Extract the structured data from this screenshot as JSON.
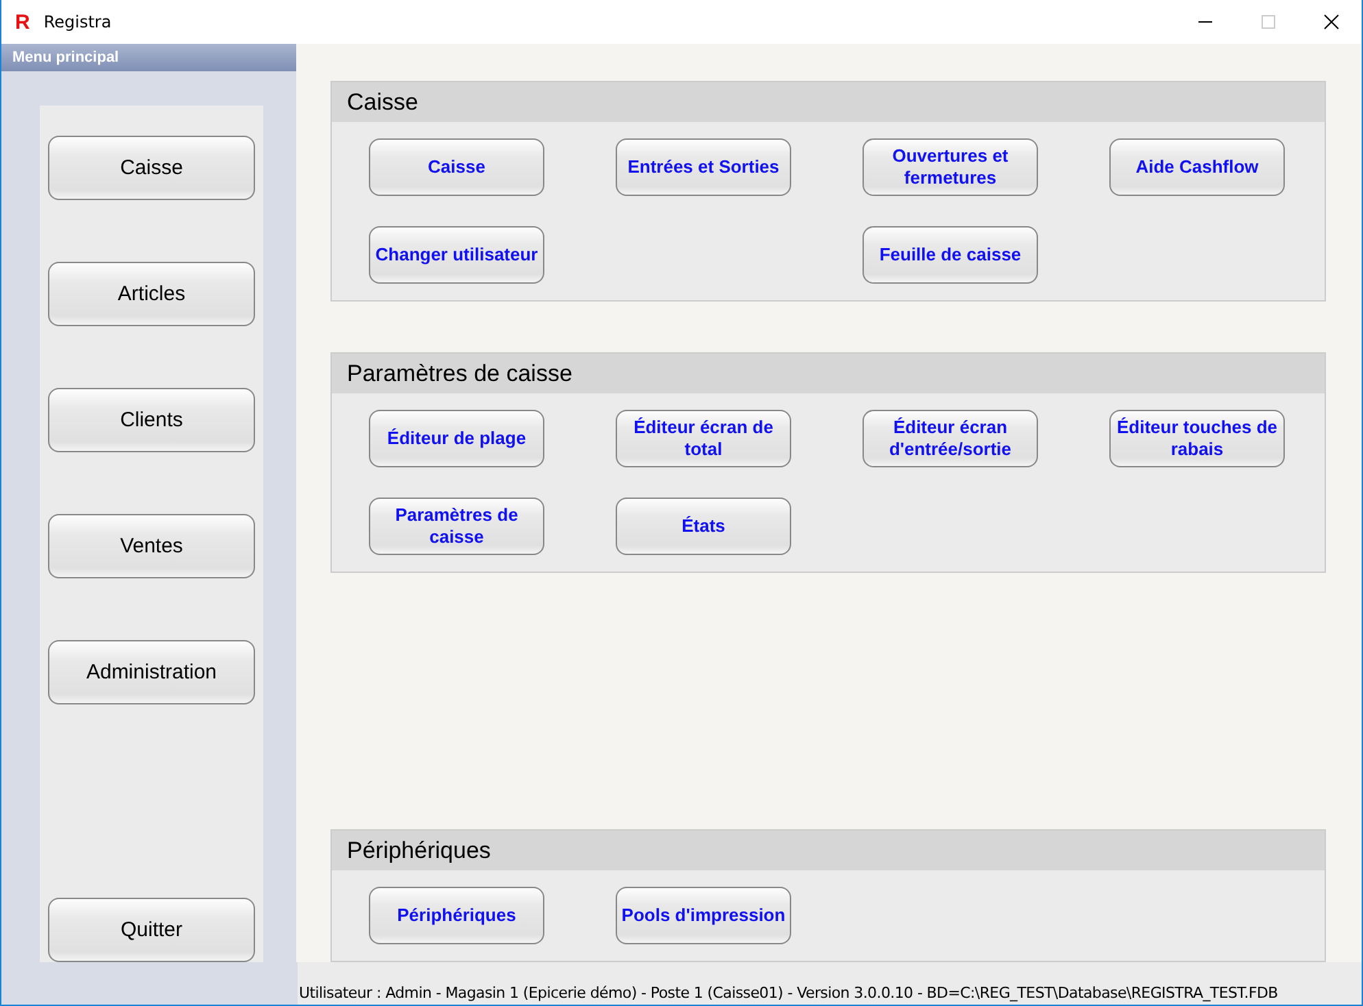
{
  "window": {
    "title": "Registra",
    "logo": "R"
  },
  "sidebar": {
    "title": "Menu principal",
    "items": [
      "Caisse",
      "Articles",
      "Clients",
      "Ventes",
      "Administration"
    ],
    "bottom_item": "Quitter"
  },
  "sections": [
    {
      "title": "Caisse",
      "rows": [
        [
          {
            "kind": "button",
            "label": "Caisse"
          },
          {
            "kind": "button",
            "label": "Entrées et Sorties"
          },
          {
            "kind": "button",
            "label": "Ouvertures et fermetures"
          },
          {
            "kind": "button",
            "label": "Aide Cashflow"
          }
        ],
        [
          {
            "kind": "button",
            "label": "Changer utilisateur"
          },
          {
            "kind": "blank"
          },
          {
            "kind": "button",
            "label": "Feuille de caisse"
          }
        ]
      ]
    },
    {
      "title": "Paramètres de caisse",
      "rows": [
        [
          {
            "kind": "button",
            "label": "Éditeur de plage"
          },
          {
            "kind": "button",
            "label": "Éditeur écran de total"
          },
          {
            "kind": "button",
            "label": "Éditeur écran d'entrée/sortie"
          },
          {
            "kind": "button",
            "label": "Éditeur touches de rabais"
          }
        ],
        [
          {
            "kind": "button",
            "label": "Paramètres de caisse"
          },
          {
            "kind": "button",
            "label": "États"
          }
        ]
      ]
    },
    {
      "title": "Périphériques",
      "rows": [
        [
          {
            "kind": "button",
            "label": "Périphériques"
          },
          {
            "kind": "button",
            "label": "Pools d'impression"
          }
        ]
      ]
    }
  ],
  "status_bar": "Utilisateur : Admin - Magasin 1 (Epicerie démo) - Poste 1 (Caisse01) - Version 3.0.0.10 - BD=C:\\REG_TEST\\Database\\REGISTRA_TEST.FDB"
}
